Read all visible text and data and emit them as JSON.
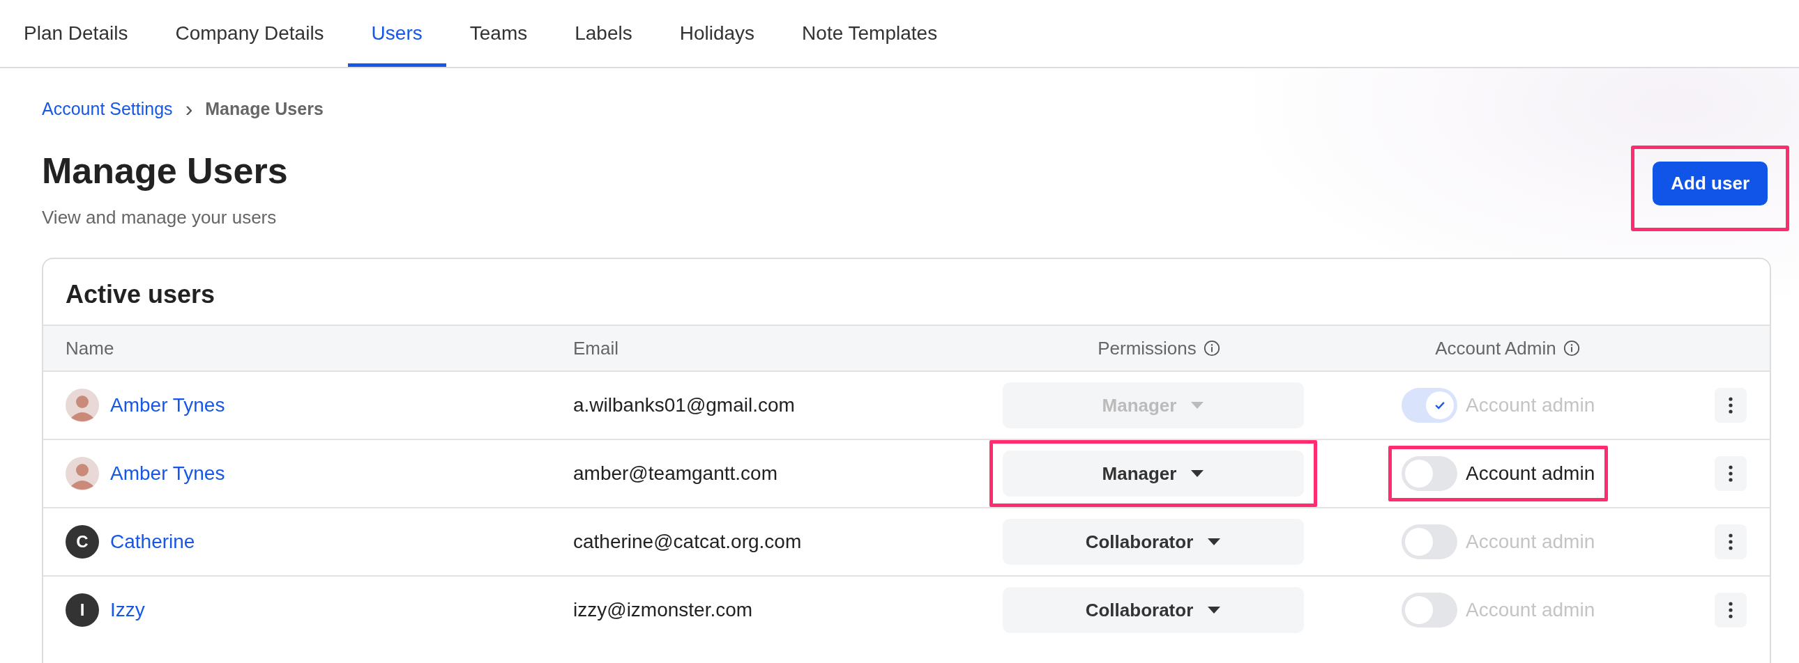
{
  "tabs": [
    {
      "label": "Plan Details",
      "selected": false
    },
    {
      "label": "Company Details",
      "selected": false
    },
    {
      "label": "Users",
      "selected": true
    },
    {
      "label": "Teams",
      "selected": false
    },
    {
      "label": "Labels",
      "selected": false
    },
    {
      "label": "Holidays",
      "selected": false
    },
    {
      "label": "Note Templates",
      "selected": false
    }
  ],
  "breadcrumb": {
    "parent": "Account Settings",
    "separator": "›",
    "current": "Manage Users"
  },
  "page": {
    "title": "Manage Users",
    "subtitle": "View and manage your users"
  },
  "add_button": {
    "label": "Add user",
    "highlighted": true
  },
  "card": {
    "title": "Active users",
    "columns": [
      {
        "label": "Name",
        "kind": "plain"
      },
      {
        "label": "Email",
        "kind": "plain"
      },
      {
        "label": "Permissions",
        "kind": "with_info"
      },
      {
        "label": "Account Admin",
        "kind": "with_info"
      }
    ],
    "rows": [
      {
        "avatar": {
          "kind": "photo"
        },
        "name": "Amber Tynes",
        "email": "a.wilbanks01@gmail.com",
        "permission": {
          "label": "Manager",
          "disabled": true
        },
        "admin": {
          "label": "Account admin",
          "on": true,
          "disabled": true
        },
        "highlighted": false
      },
      {
        "avatar": {
          "kind": "photo"
        },
        "name": "Amber Tynes",
        "email": "amber@teamgantt.com",
        "permission": {
          "label": "Manager",
          "disabled": false
        },
        "admin": {
          "label": "Account admin",
          "on": false,
          "disabled": false
        },
        "highlighted": true
      },
      {
        "avatar": {
          "kind": "initial",
          "letter": "C"
        },
        "name": "Catherine",
        "email": "catherine@catcat.org.com",
        "permission": {
          "label": "Collaborator",
          "disabled": false
        },
        "admin": {
          "label": "Account admin",
          "on": false,
          "disabled": true
        },
        "highlighted": false
      },
      {
        "avatar": {
          "kind": "initial",
          "letter": "I"
        },
        "name": "Izzy",
        "email": "izzy@izmonster.com",
        "permission": {
          "label": "Collaborator",
          "disabled": false
        },
        "admin": {
          "label": "Account admin",
          "on": false,
          "disabled": true
        },
        "highlighted": false
      }
    ]
  }
}
